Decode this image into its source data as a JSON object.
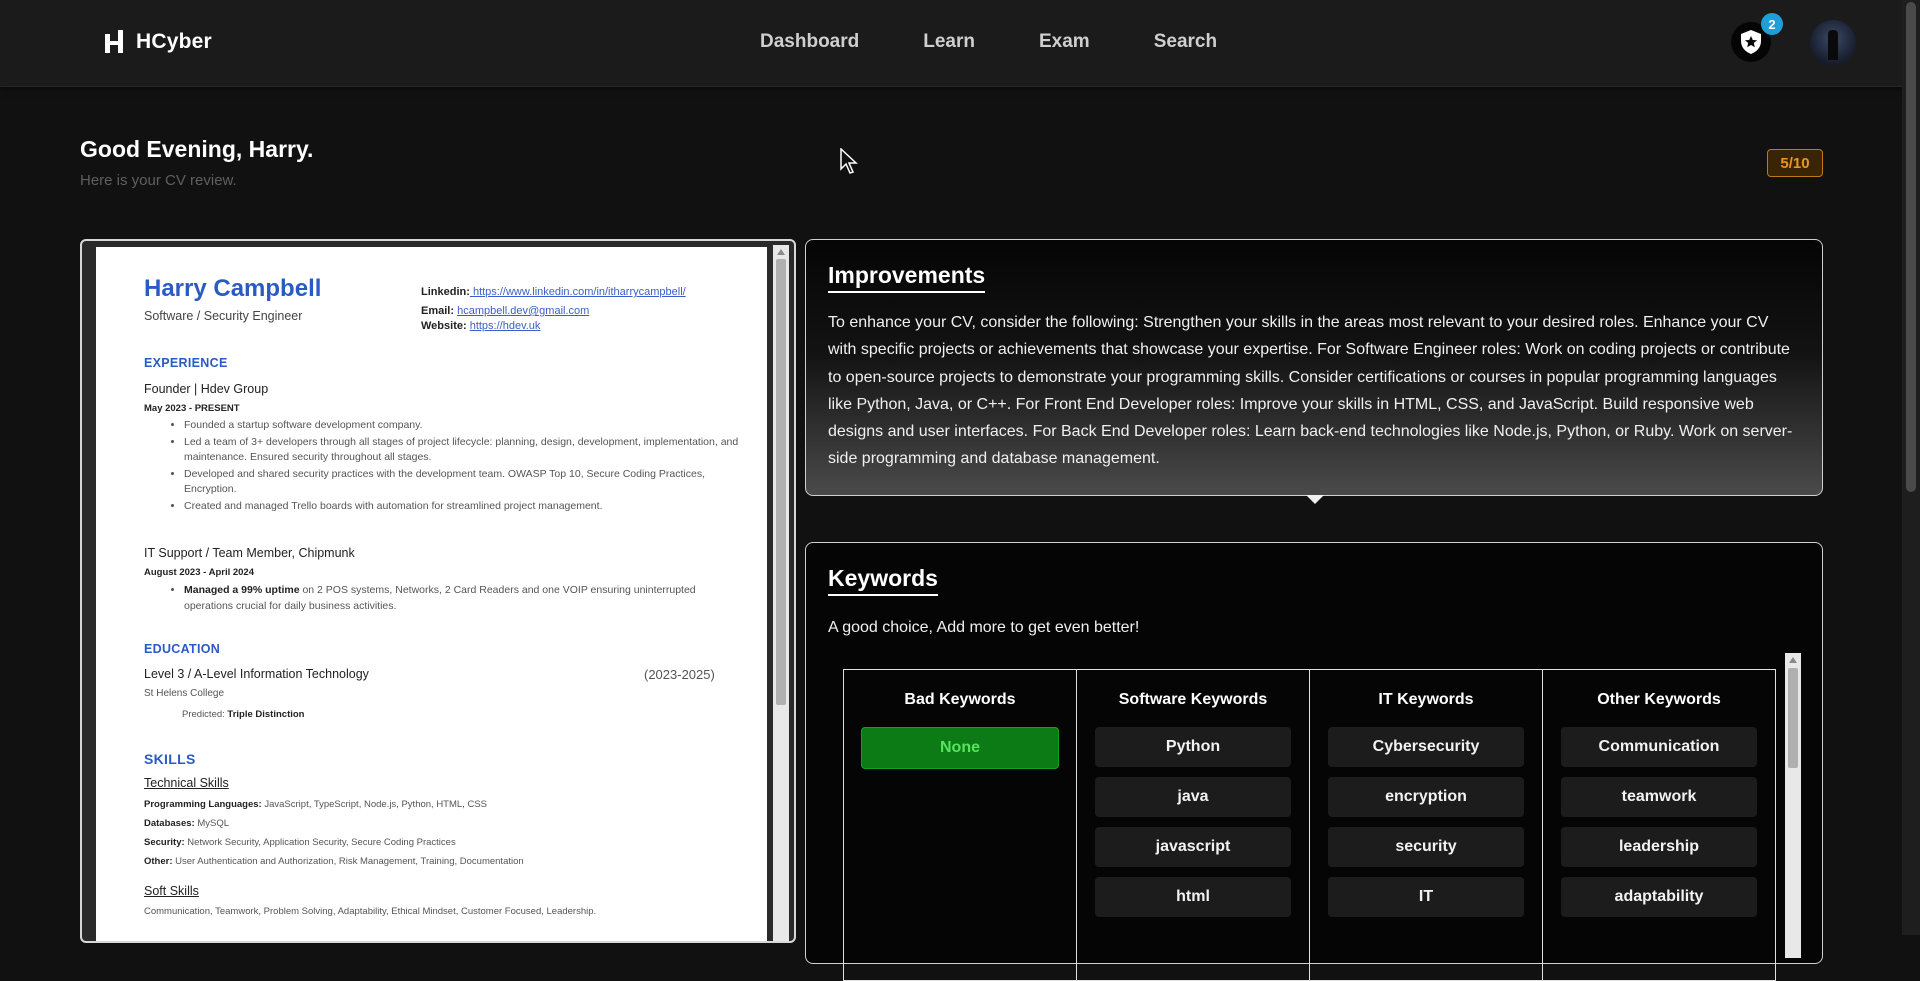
{
  "brand": {
    "name": "HCyber"
  },
  "nav": [
    "Dashboard",
    "Learn",
    "Exam",
    "Search"
  ],
  "header": {
    "notification_count": "2",
    "badge_icon": "shield-star-icon",
    "avatar_icon": "avatar"
  },
  "greeting": {
    "title": "Good Evening, Harry.",
    "subtitle": "Here is your CV review.",
    "score": "5/10"
  },
  "cv": {
    "name": "Harry Campbell",
    "role": "Software / Security Engineer",
    "linkedin_label": "Linkedin:",
    "linkedin": " https://www.linkedin.com/in/itharrycampbell/",
    "email_label": "Email:",
    "email": "hcampbell.dev@gmail.com",
    "website_label": "Website:",
    "website": "https://hdev.uk",
    "experience_heading": "EXPERIENCE",
    "job1_title": "Founder | Hdev Group",
    "job1_date": "May 2023 - PRESENT",
    "job1_bullets": [
      "Founded a startup software development company.",
      "Led a team of 3+ developers through all stages of project lifecycle: planning, design, development, implementation, and maintenance. Ensured security throughout all stages.",
      "Developed and shared security practices with the development team. OWASP Top 10, Secure Coding Practices, Encryption.",
      "Created and managed Trello boards with automation for streamlined project management."
    ],
    "job2_title": "IT Support / Team Member, Chipmunk",
    "job2_date": "August 2023 - April 2024",
    "job2_bullet_bold": "Managed a 99% uptime",
    "job2_bullet_rest": " on 2 POS systems, Networks, 2 Card Readers and one VOIP ensuring uninterrupted operations crucial for daily business activities.",
    "education_heading": "EDUCATION",
    "edu_title": "Level 3 / A-Level Information Technology",
    "edu_years": "(2023-2025)",
    "edu_school": "St Helens College",
    "edu_predicted_label": "Predicted: ",
    "edu_predicted": "Triple Distinction",
    "skills_heading": "SKILLS",
    "technical_heading": "Technical Skills",
    "skill_rows": [
      {
        "label": "Programming Languages:",
        "value": " JavaScript, TypeScript, Node.js, Python, HTML, CSS"
      },
      {
        "label": "Databases:",
        "value": " MySQL"
      },
      {
        "label": "Security:",
        "value": " Network Security, Application Security, Secure Coding Practices"
      },
      {
        "label": "Other:",
        "value": " User Authentication and Authorization, Risk Management, Training, Documentation"
      }
    ],
    "soft_heading": "Soft Skills",
    "soft_skills": "Communication, Teamwork, Problem Solving, Adaptability, Ethical Mindset, Customer Focused, Leadership."
  },
  "improvements": {
    "title": "Improvements",
    "text": "To enhance your CV, consider the following: Strengthen your skills in the areas most relevant to your desired roles. Enhance your CV with specific projects or achievements that showcase your expertise. For Software Engineer roles: Work on coding projects or contribute to open-source projects to demonstrate your programming skills. Consider certifications or courses in popular programming languages like Python, Java, or C++. For Front End Developer roles: Improve your skills in HTML, CSS, and JavaScript. Build responsive web designs and user interfaces. For Back End Developer roles: Learn back-end technologies like Node.js, Python, or Ruby. Work on server-side programming and database management."
  },
  "keywords": {
    "title": "Keywords",
    "text": "A good choice, Add more to get even better!",
    "columns": [
      {
        "heading": "Bad Keywords",
        "items": [
          "None"
        ]
      },
      {
        "heading": "Software Keywords",
        "items": [
          "Python",
          "java",
          "javascript",
          "html"
        ]
      },
      {
        "heading": "IT Keywords",
        "items": [
          "Cybersecurity",
          "encryption",
          "security",
          "IT"
        ]
      },
      {
        "heading": "Other Keywords",
        "items": [
          "Communication",
          "teamwork",
          "leadership",
          "adaptability"
        ]
      }
    ]
  }
}
